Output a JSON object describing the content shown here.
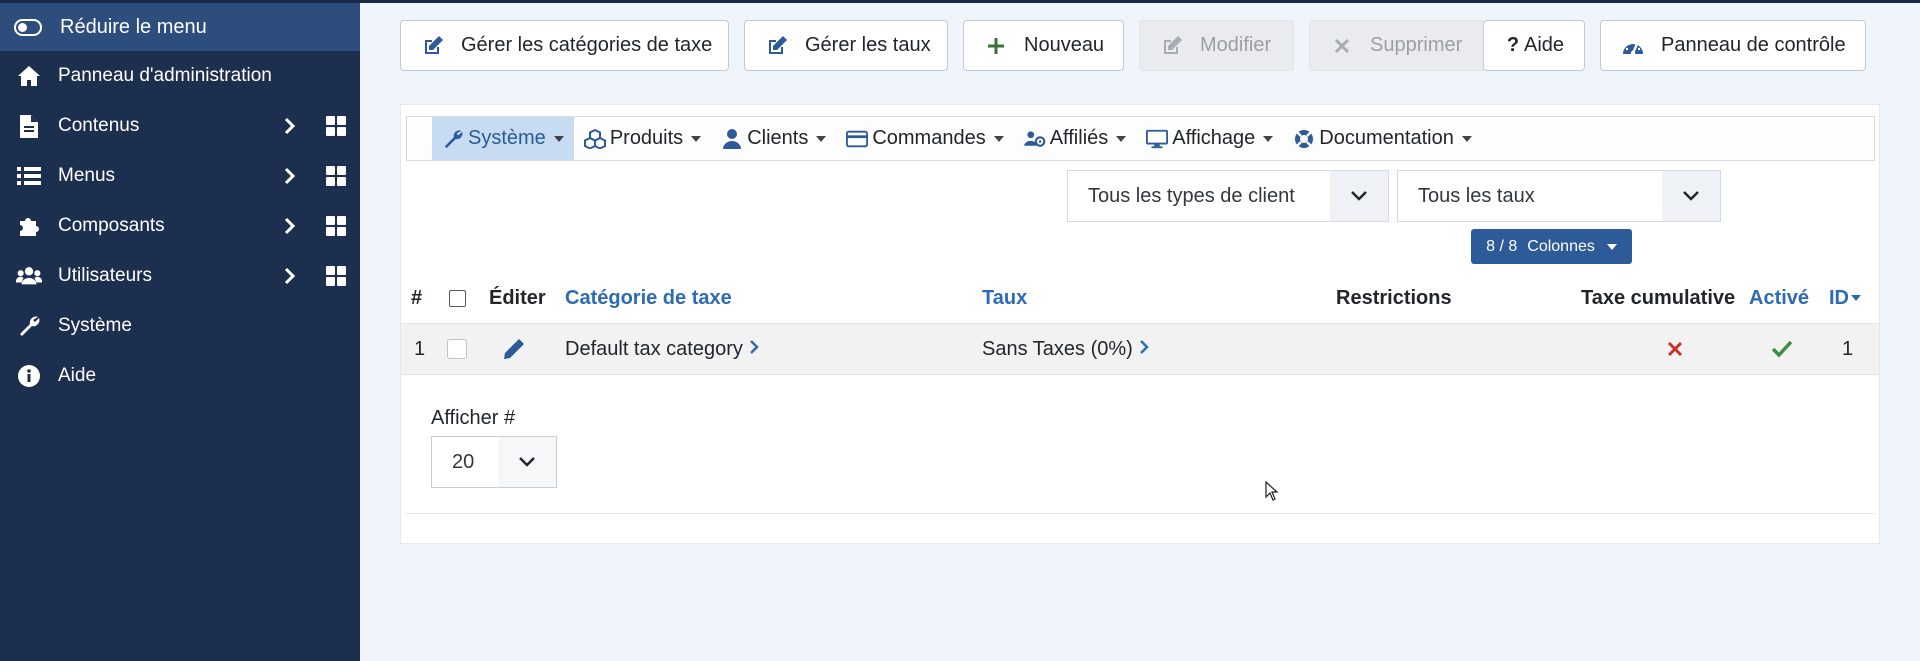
{
  "sidebar": {
    "toggle_label": "Réduire le menu",
    "items": [
      {
        "label": "Panneau d'administration",
        "icon": "home-icon"
      },
      {
        "label": "Contenus",
        "icon": "file-icon"
      },
      {
        "label": "Menus",
        "icon": "list-icon"
      },
      {
        "label": "Composants",
        "icon": "puzzle-icon"
      },
      {
        "label": "Utilisateurs",
        "icon": "users-icon"
      },
      {
        "label": "Système",
        "icon": "wrench-icon"
      },
      {
        "label": "Aide",
        "icon": "info-icon"
      }
    ]
  },
  "toolbar": {
    "tax_categories": "Gérer les catégories de taxe",
    "rates": "Gérer les taux",
    "new": "Nouveau",
    "edit": "Modifier",
    "delete": "Supprimer",
    "help": "Aide",
    "control_panel": "Panneau de contrôle"
  },
  "menubar": {
    "items": [
      "Système",
      "Produits",
      "Clients",
      "Commandes",
      "Affiliés",
      "Affichage",
      "Documentation"
    ]
  },
  "filters": {
    "customer_type": "Tous les types de client",
    "rates": "Tous les taux",
    "columns_count": "8 / 8",
    "columns_label": "Colonnes"
  },
  "table": {
    "headers": {
      "num": "#",
      "edit": "Éditer",
      "category": "Catégorie de taxe",
      "rate": "Taux",
      "restrictions": "Restrictions",
      "cumulative": "Taxe cumulative",
      "enabled": "Activé",
      "id": "ID"
    },
    "rows": [
      {
        "num": "1",
        "category": "Default tax category",
        "rate": "Sans Taxes (0%)",
        "restrictions": "",
        "cumulative": false,
        "enabled": true,
        "id": "1"
      }
    ]
  },
  "pagination": {
    "show_label": "Afficher #",
    "show_value": "20"
  },
  "colors": {
    "sidebar_bg": "#1c2f4f",
    "sidebar_active": "#2d4d7c",
    "link_blue": "#2d6bb5",
    "danger_red": "#c9302c",
    "success_green": "#3c8d40"
  }
}
